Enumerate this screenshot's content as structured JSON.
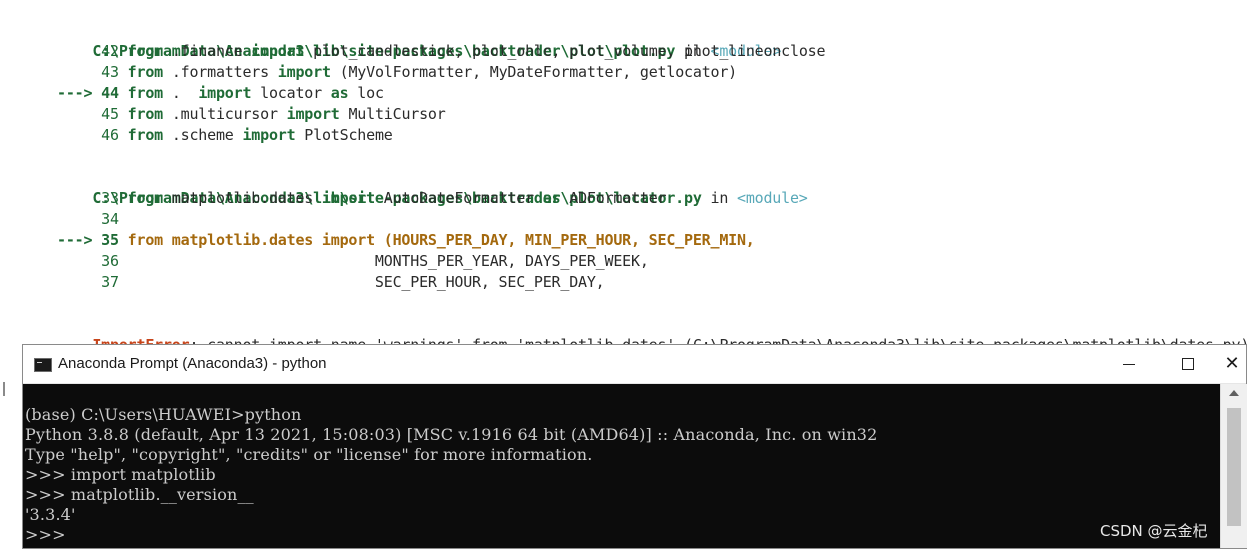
{
  "traceback": {
    "frame1": {
      "path": "C:\\ProgramData\\Anaconda3\\lib\\site-packages\\backtrader\\plot\\plot.py",
      "in": " in ",
      "module": "<module>",
      "lines": [
        {
          "prefix": "     ",
          "num": "42",
          "code": [
            [
              "kw",
              "from"
            ],
            [
              "t",
              " .finance "
            ],
            [
              "kw",
              "import"
            ],
            [
              "t",
              " plot_candlestick, plot_ohlc, plot_volume, plot_lineonclose"
            ]
          ]
        },
        {
          "prefix": "     ",
          "num": "43",
          "code": [
            [
              "kw",
              "from"
            ],
            [
              "t",
              " .formatters "
            ],
            [
              "kw",
              "import"
            ],
            [
              "t",
              " (MyVolFormatter, MyDateFormatter, getlocator)"
            ]
          ]
        },
        {
          "prefix": "---> ",
          "num": "44",
          "code": [
            [
              "kw",
              "from"
            ],
            [
              "t",
              " .  "
            ],
            [
              "kw",
              "import"
            ],
            [
              "t",
              " locator "
            ],
            [
              "kw",
              "as"
            ],
            [
              "t",
              " loc"
            ]
          ]
        },
        {
          "prefix": "     ",
          "num": "45",
          "code": [
            [
              "kw",
              "from"
            ],
            [
              "t",
              " .multicursor "
            ],
            [
              "kw",
              "import"
            ],
            [
              "t",
              " MultiCursor"
            ]
          ]
        },
        {
          "prefix": "     ",
          "num": "46",
          "code": [
            [
              "kw",
              "from"
            ],
            [
              "t",
              " .scheme "
            ],
            [
              "kw",
              "import"
            ],
            [
              "t",
              " PlotScheme"
            ]
          ]
        }
      ]
    },
    "frame2": {
      "path": "C:\\ProgramData\\Anaconda3\\lib\\site-packages\\backtrader\\plot\\locator.py",
      "in": " in ",
      "module": "<module>",
      "lines": [
        {
          "prefix": "     ",
          "num": "33",
          "code": [
            [
              "kw",
              "from"
            ],
            [
              "t",
              " matplotlib.dates "
            ],
            [
              "kw",
              "import"
            ],
            [
              "t",
              " AutoDateFormatter "
            ],
            [
              "kw",
              "as"
            ],
            [
              "t",
              " ADFormatter"
            ]
          ]
        },
        {
          "prefix": "     ",
          "num": "34",
          "code": []
        },
        {
          "prefix": "---> ",
          "num": "35",
          "code": [
            [
              "hl",
              "from matplotlib.dates import (HOURS_PER_DAY, MIN_PER_HOUR, SEC_PER_MIN,"
            ]
          ]
        },
        {
          "prefix": "     ",
          "num": "36",
          "code": [
            [
              "t",
              "                            MONTHS_PER_YEAR, DAYS_PER_WEEK,"
            ]
          ]
        },
        {
          "prefix": "     ",
          "num": "37",
          "code": [
            [
              "t",
              "                            SEC_PER_HOUR, SEC_PER_DAY,"
            ]
          ]
        }
      ]
    },
    "error": {
      "name": "ImportError",
      "message": ": cannot import name 'warnings' from 'matplotlib.dates' (C:\\ProgramData\\Anaconda3\\lib\\site-packages\\matplotlib\\dates.py)"
    }
  },
  "window": {
    "title": "Anaconda Prompt (Anaconda3) - python",
    "minimize_glyph": "",
    "maximize_glyph": "",
    "close_glyph": "✕",
    "icon": "console-window-icon"
  },
  "console": {
    "lines": [
      "",
      "(base) C:\\Users\\HUAWEI>python",
      "Python 3.8.8 (default, Apr 13 2021, 15:08:03) [MSC v.1916 64 bit (AMD64)] :: Anaconda, Inc. on win32",
      "Type \"help\", \"copyright\", \"credits\" or \"license\" for more information.",
      ">>> import matplotlib",
      ">>> matplotlib.__version__",
      "'3.3.4'",
      ">>>"
    ]
  },
  "watermark": "CSDN @云金杞",
  "colors": {
    "path_green": "#1f6b36",
    "module_cyan": "#58a8b8",
    "highlight_amber": "#a4690e",
    "error_red": "#c7441a",
    "console_bg": "#0c0c0c",
    "console_fg": "#cccccc"
  }
}
